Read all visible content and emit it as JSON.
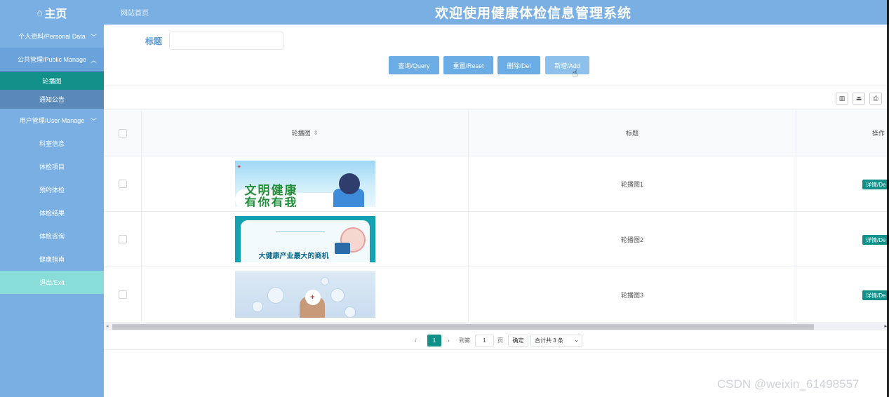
{
  "header": {
    "home_label": "主页",
    "breadcrumb": "网站首页",
    "system_title": "欢迎使用健康体检信息管理系统"
  },
  "sidebar": {
    "items": [
      {
        "label": "个人资料/Personal Data",
        "chevron": "﹀"
      },
      {
        "label": "公共管理/Public Manage",
        "chevron": "︿"
      },
      {
        "label": "轮播图"
      },
      {
        "label": "通知公告"
      },
      {
        "label": "用户管理/User Manage",
        "chevron": "﹀"
      },
      {
        "label": "科室信息"
      },
      {
        "label": "体检项目"
      },
      {
        "label": "预约体检"
      },
      {
        "label": "体检结果"
      },
      {
        "label": "体检咨询"
      },
      {
        "label": "健康指南"
      },
      {
        "label": "退出/Exit"
      }
    ]
  },
  "search": {
    "title_label": "标题",
    "title_value": ""
  },
  "buttons": {
    "query": "查询/Query",
    "reset": "重置/Reset",
    "delete": "删除/Del",
    "add": "新增/Add"
  },
  "table": {
    "headers": {
      "image": "轮播图",
      "title": "标题",
      "actions": "操作"
    },
    "rows": [
      {
        "title": "轮播图1",
        "action": "详情/De",
        "banner_text_1": "文明健康",
        "banner_text_2": "有你有我"
      },
      {
        "title": "轮播图2",
        "action": "详情/De",
        "banner_text": "大健康产业最大的商机"
      },
      {
        "title": "轮播图3",
        "action": "详情/De"
      }
    ]
  },
  "pagination": {
    "prev": "‹",
    "current_page": "1",
    "next": "›",
    "goto_prefix": "到第",
    "goto_value": "1",
    "goto_suffix": "页",
    "confirm": "确定",
    "total": "合计共 3 条"
  },
  "watermark": "CSDN @weixin_61498557",
  "colors": {
    "header_bg": "#7aafe3",
    "accent_teal": "#11908a",
    "button_blue": "#6aace3",
    "exit_bg": "#88ddd9"
  }
}
